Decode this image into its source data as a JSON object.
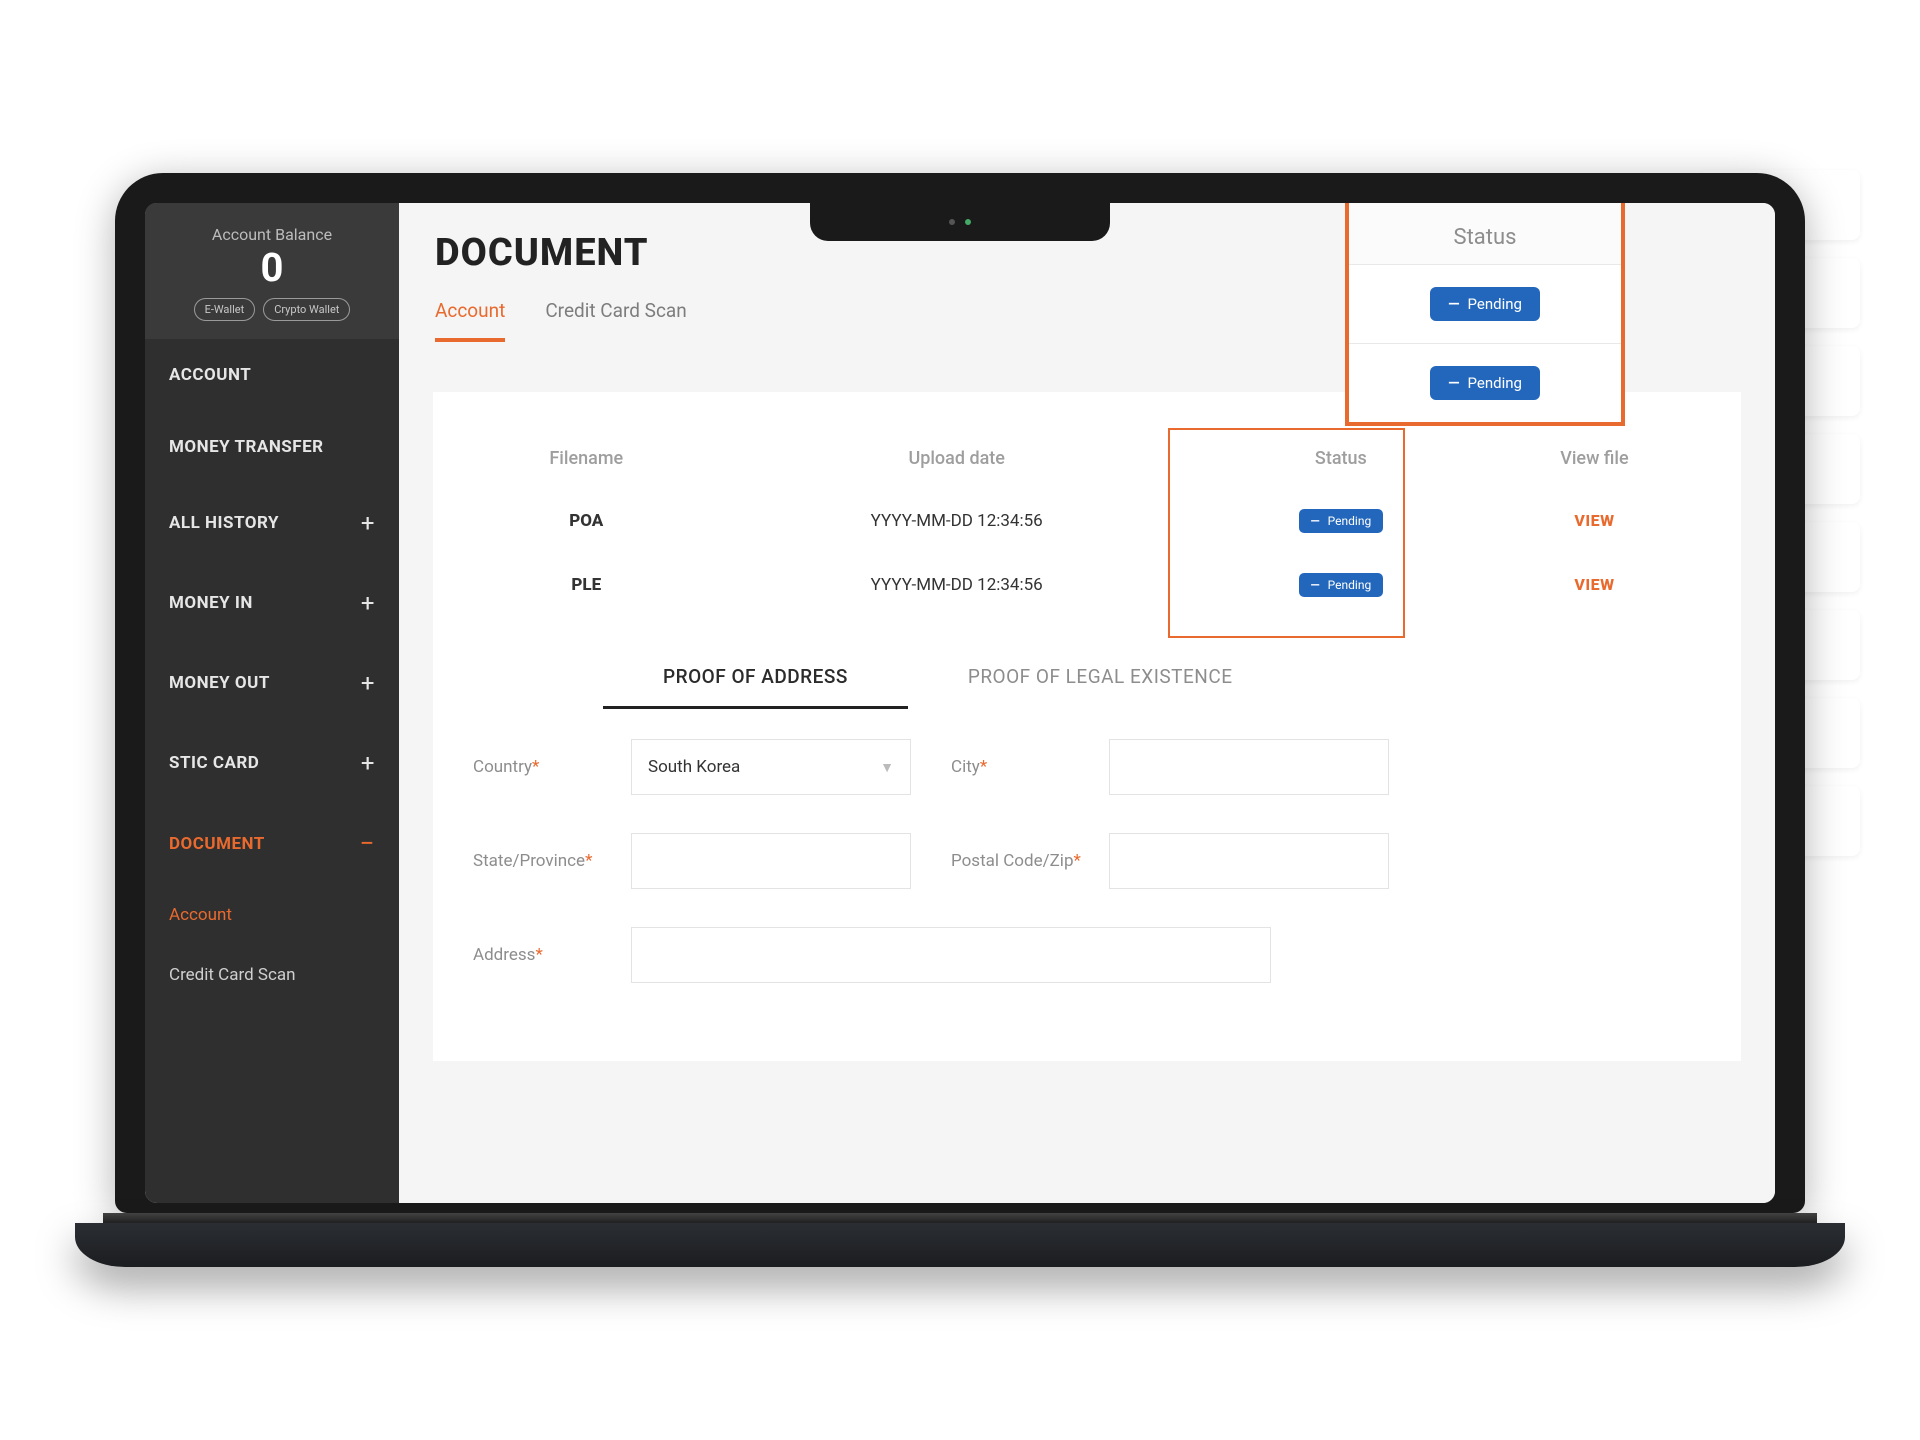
{
  "sidebar": {
    "balance_label": "Account Balance",
    "balance_value": "0",
    "pills": {
      "ewallet": "E-Wallet",
      "crypto": "Crypto Wallet"
    },
    "items": [
      {
        "label": "ACCOUNT",
        "expandable": false
      },
      {
        "label": "MONEY TRANSFER",
        "expandable": false
      },
      {
        "label": "ALL HISTORY",
        "expandable": true
      },
      {
        "label": "MONEY IN",
        "expandable": true
      },
      {
        "label": "MONEY OUT",
        "expandable": true
      },
      {
        "label": "STIC CARD",
        "expandable": true
      },
      {
        "label": "DOCUMENT",
        "expandable": true,
        "active": true
      }
    ],
    "sub": [
      {
        "label": "Account",
        "active": true
      },
      {
        "label": "Credit Card Scan",
        "active": false
      }
    ]
  },
  "page": {
    "title": "DOCUMENT",
    "tabs": {
      "account": "Account",
      "ccscan": "Credit Card Scan"
    }
  },
  "callout": {
    "header": "Status",
    "badge1": "Pending",
    "badge2": "Pending"
  },
  "table": {
    "headers": {
      "filename": "Filename",
      "upload": "Upload date",
      "status": "Status",
      "view": "View file"
    },
    "rows": [
      {
        "filename": "POA",
        "upload": "YYYY-MM-DD 12:34:56",
        "status": "Pending",
        "view": "VIEW"
      },
      {
        "filename": "PLE",
        "upload": "YYYY-MM-DD 12:34:56",
        "status": "Pending",
        "view": "VIEW"
      }
    ]
  },
  "proof_tabs": {
    "poa": "PROOF OF ADDRESS",
    "ple": "PROOF OF LEGAL EXISTENCE"
  },
  "form": {
    "country_label": "Country",
    "country_value": "South Korea",
    "city_label": "City",
    "state_label": "State/Province",
    "postal_label": "Postal Code/Zip",
    "address_label": "Address",
    "required_mark": "*"
  }
}
